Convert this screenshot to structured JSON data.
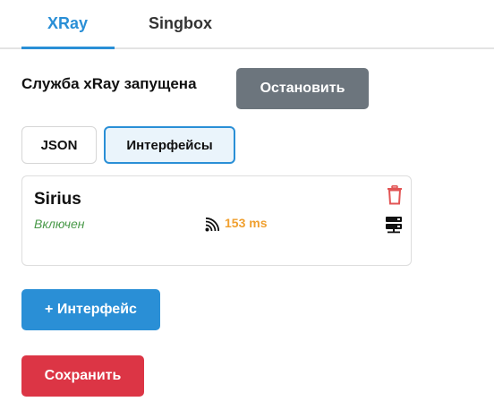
{
  "tabs": [
    {
      "label": "XRay",
      "active": true
    },
    {
      "label": "Singbox",
      "active": false
    }
  ],
  "status": {
    "text": "Служба xRay запущена",
    "stop_button": "Остановить"
  },
  "view_toggles": [
    {
      "label": "JSON",
      "active": false
    },
    {
      "label": "Интерфейсы",
      "active": true
    }
  ],
  "interfaces": [
    {
      "name": "Sirius",
      "state": "Включен",
      "latency": "153 ms",
      "icons": [
        "signal-icon",
        "trash-icon",
        "server-icon"
      ]
    }
  ],
  "actions": {
    "add_interface": "+ Интерфейс",
    "save": "Сохранить"
  },
  "colors": {
    "accent": "#2a8fd6",
    "stop_button": "#6c757d",
    "save_button": "#dc3545",
    "status_enabled": "#4a9a4a",
    "latency": "#f0a030",
    "delete_icon": "#e25555"
  }
}
